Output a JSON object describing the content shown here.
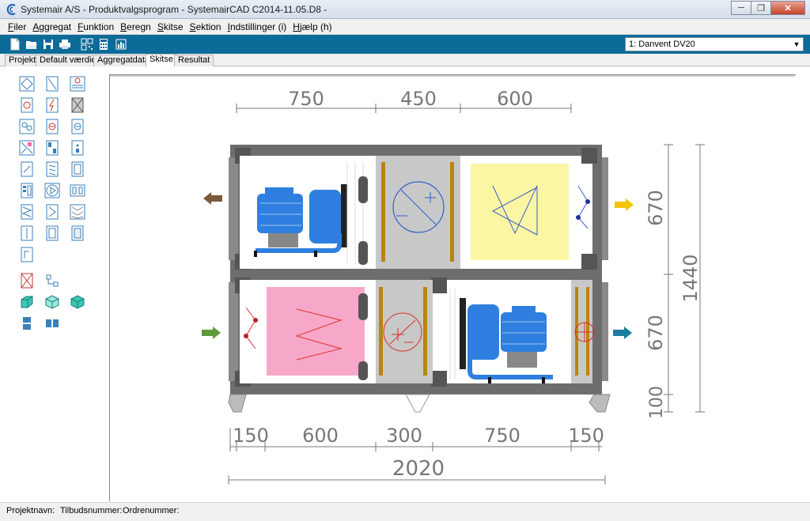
{
  "window": {
    "title": "Systemair A/S - Produktvalgsprogram - SystemairCAD C2014-11.05.D8 -",
    "minimize": "─",
    "restore": "❐",
    "close": "✕"
  },
  "menu": [
    "Filer",
    "Aggregat",
    "Funktion",
    "Beregn",
    "Skitse",
    "Sektion",
    "Indstillinger (i)",
    "Hjælp (h)"
  ],
  "toolbar": {
    "unit_selector": "1:  Danvent DV20"
  },
  "tabs": [
    "Projekt",
    "Default værdier",
    "Aggregatdata",
    "Skitse",
    "Resultat"
  ],
  "active_tab": "Skitse",
  "drawing": {
    "top_dims": [
      "750",
      "450",
      "600"
    ],
    "bottom_dims": [
      "150",
      "600",
      "300",
      "750",
      "150"
    ],
    "total_length": "2020",
    "right_dims_inner": [
      "670",
      "670",
      "100"
    ],
    "total_height": "1440",
    "colors": {
      "frame": "#6d6d6d",
      "fan_blue": "#2f7fe0",
      "filter_yellow": "#fbf6a3",
      "filter_pink": "#f7a8c8",
      "coil_brown": "#b8860b",
      "arrow_brown": "#7a5a3c",
      "arrow_yellow": "#f2c500",
      "arrow_green": "#5c9a3a",
      "arrow_teal": "#1a7fa0"
    }
  },
  "status": {
    "project_name": "Projektnavn:",
    "offer_number": "Tilbudsnummer:",
    "order_number": "Ordrenummer:"
  }
}
